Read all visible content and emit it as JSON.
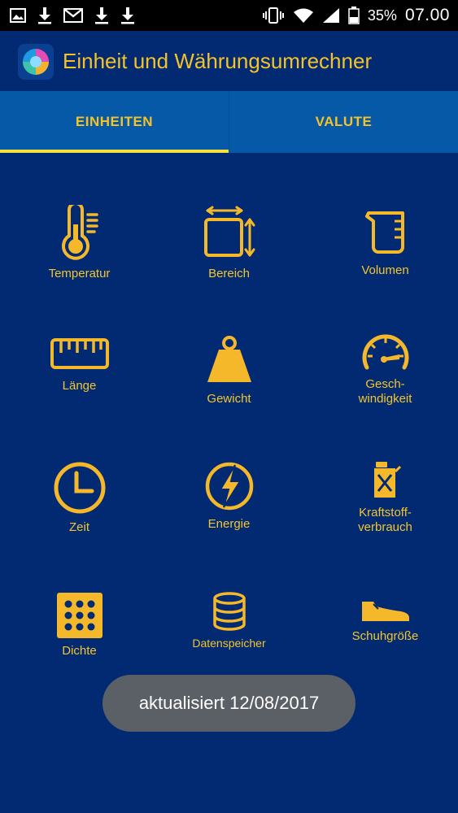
{
  "status_bar": {
    "battery_percent": "35%",
    "time": "07.00",
    "left_icons": [
      "image-icon",
      "download-icon",
      "gmail-icon",
      "download-icon",
      "download-icon"
    ],
    "right_icons": [
      "vibrate-icon",
      "wifi-icon",
      "signal-icon",
      "battery-icon"
    ]
  },
  "app": {
    "title": "Einheit und Währungsumrechner",
    "logo_icon": "app-logo-icon"
  },
  "tabs": [
    {
      "label": "EINHEITEN",
      "active": true
    },
    {
      "label": "VALUTE",
      "active": false
    }
  ],
  "categories": [
    {
      "label": "Temperatur",
      "icon": "thermometer-icon"
    },
    {
      "label": "Bereich",
      "icon": "area-icon"
    },
    {
      "label": "Volumen",
      "icon": "measuring-cup-icon"
    },
    {
      "label": "Länge",
      "icon": "ruler-icon"
    },
    {
      "label": "Gewicht",
      "icon": "weight-icon"
    },
    {
      "label": "Geschwindigkeit",
      "label_line1": "Gesch-",
      "label_line2": "windigkeit",
      "icon": "speedometer-icon"
    },
    {
      "label": "Zeit",
      "icon": "clock-icon"
    },
    {
      "label": "Energie",
      "icon": "lightning-icon"
    },
    {
      "label": "Kraftstoffverbrauch",
      "label_line1": "Kraftstoff-",
      "label_line2": "verbrauch",
      "icon": "fuel-can-icon"
    },
    {
      "label": "Dichte",
      "icon": "density-grid-icon"
    },
    {
      "label": "Datenspeicher",
      "icon": "database-icon"
    },
    {
      "label": "Schuhgröße",
      "icon": "shoe-icon"
    }
  ],
  "toast": {
    "text": "aktualisiert 12/08/2017"
  },
  "colors": {
    "background": "#022a72",
    "tab_bar": "#0659a6",
    "accent": "#f5c327",
    "tab_indicator": "#f5e23a",
    "toast_bg": "#5b5f66"
  }
}
